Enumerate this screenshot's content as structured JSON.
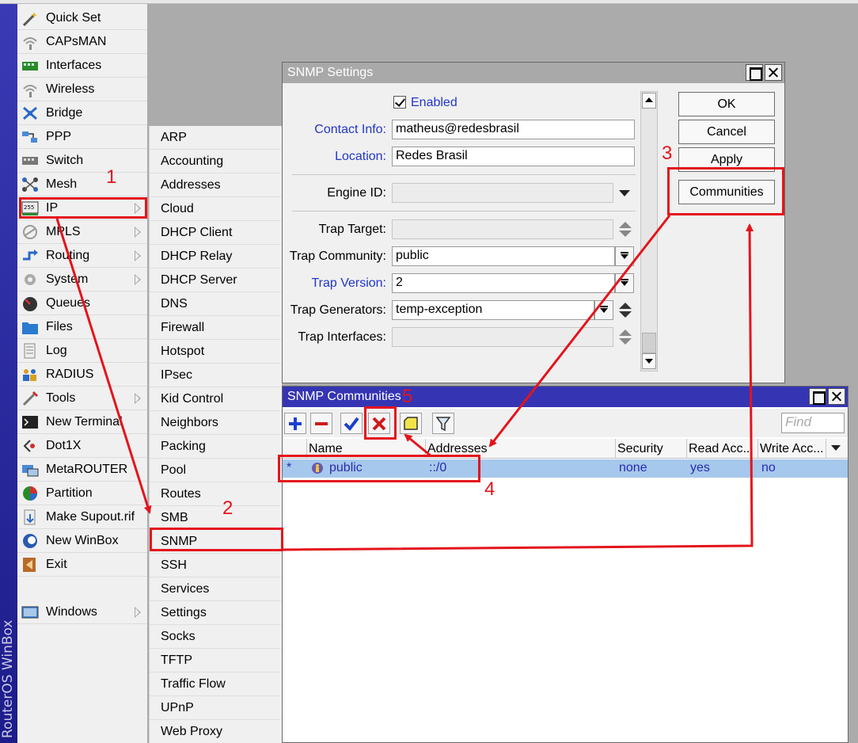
{
  "app": {
    "brand": "RouterOS WinBox"
  },
  "main_menu": [
    {
      "label": "Quick Set",
      "icon": "wand-icon",
      "arrow": false
    },
    {
      "label": "CAPsMAN",
      "icon": "capsman-icon",
      "arrow": false
    },
    {
      "label": "Interfaces",
      "icon": "interfaces-icon",
      "arrow": false
    },
    {
      "label": "Wireless",
      "icon": "wireless-icon",
      "arrow": false
    },
    {
      "label": "Bridge",
      "icon": "bridge-icon",
      "arrow": false
    },
    {
      "label": "PPP",
      "icon": "ppp-icon",
      "arrow": false
    },
    {
      "label": "Switch",
      "icon": "switch-icon",
      "arrow": false
    },
    {
      "label": "Mesh",
      "icon": "mesh-icon",
      "arrow": false
    },
    {
      "label": "IP",
      "icon": "ip-icon",
      "arrow": true
    },
    {
      "label": "MPLS",
      "icon": "mpls-icon",
      "arrow": true
    },
    {
      "label": "Routing",
      "icon": "routing-icon",
      "arrow": true
    },
    {
      "label": "System",
      "icon": "system-gear-icon",
      "arrow": true
    },
    {
      "label": "Queues",
      "icon": "queues-icon",
      "arrow": false
    },
    {
      "label": "Files",
      "icon": "folder-icon",
      "arrow": false
    },
    {
      "label": "Log",
      "icon": "log-icon",
      "arrow": false
    },
    {
      "label": "RADIUS",
      "icon": "radius-icon",
      "arrow": false
    },
    {
      "label": "Tools",
      "icon": "tools-icon",
      "arrow": true
    },
    {
      "label": "New Terminal",
      "icon": "terminal-icon",
      "arrow": false
    },
    {
      "label": "Dot1X",
      "icon": "dot1x-icon",
      "arrow": false
    },
    {
      "label": "MetaROUTER",
      "icon": "metarouter-icon",
      "arrow": false
    },
    {
      "label": "Partition",
      "icon": "partition-icon",
      "arrow": false
    },
    {
      "label": "Make Supout.rif",
      "icon": "supout-icon",
      "arrow": false
    },
    {
      "label": "New WinBox",
      "icon": "winbox-icon",
      "arrow": false
    },
    {
      "label": "Exit",
      "icon": "exit-icon",
      "arrow": false
    },
    {
      "label": "Windows",
      "icon": "windows-icon",
      "arrow": true
    }
  ],
  "ip_submenu": [
    "ARP",
    "Accounting",
    "Addresses",
    "Cloud",
    "DHCP Client",
    "DHCP Relay",
    "DHCP Server",
    "DNS",
    "Firewall",
    "Hotspot",
    "IPsec",
    "Kid Control",
    "Neighbors",
    "Packing",
    "Pool",
    "Routes",
    "SMB",
    "SNMP",
    "SSH",
    "Services",
    "Settings",
    "Socks",
    "TFTP",
    "Traffic Flow",
    "UPnP",
    "Web Proxy"
  ],
  "snmp_settings": {
    "title": "SNMP Settings",
    "enabled_label": "Enabled",
    "enabled": true,
    "contact_info_label": "Contact Info:",
    "contact_info": "matheus@redesbrasil",
    "location_label": "Location:",
    "location": "Redes Brasil",
    "engine_id_label": "Engine ID:",
    "engine_id": "",
    "trap_target_label": "Trap Target:",
    "trap_target": "",
    "trap_community_label": "Trap Community:",
    "trap_community": "public",
    "trap_version_label": "Trap Version:",
    "trap_version": "2",
    "trap_generators_label": "Trap Generators:",
    "trap_generators": "temp-exception",
    "trap_interfaces_label": "Trap Interfaces:",
    "trap_interfaces": "",
    "buttons": {
      "ok": "OK",
      "cancel": "Cancel",
      "apply": "Apply",
      "communities": "Communities"
    }
  },
  "snmp_communities": {
    "title": "SNMP Communities",
    "find_placeholder": "Find",
    "columns": [
      "Name",
      "Addresses",
      "Security",
      "Read Acc...",
      "Write Acc..."
    ],
    "rows": [
      {
        "marker": "*",
        "name": "public",
        "addresses": "::/0",
        "security": "none",
        "read_access": "yes",
        "write_access": "no"
      }
    ]
  },
  "annotations": {
    "n1": "1",
    "n2": "2",
    "n3": "3",
    "n4": "4",
    "n5": "5"
  },
  "colors": {
    "annotation": "#e4141c",
    "active_title": "#3535b4",
    "inactive_title": "#a9a9a9",
    "selected_row": "#a6c8ec",
    "link_label": "#2136c8"
  }
}
